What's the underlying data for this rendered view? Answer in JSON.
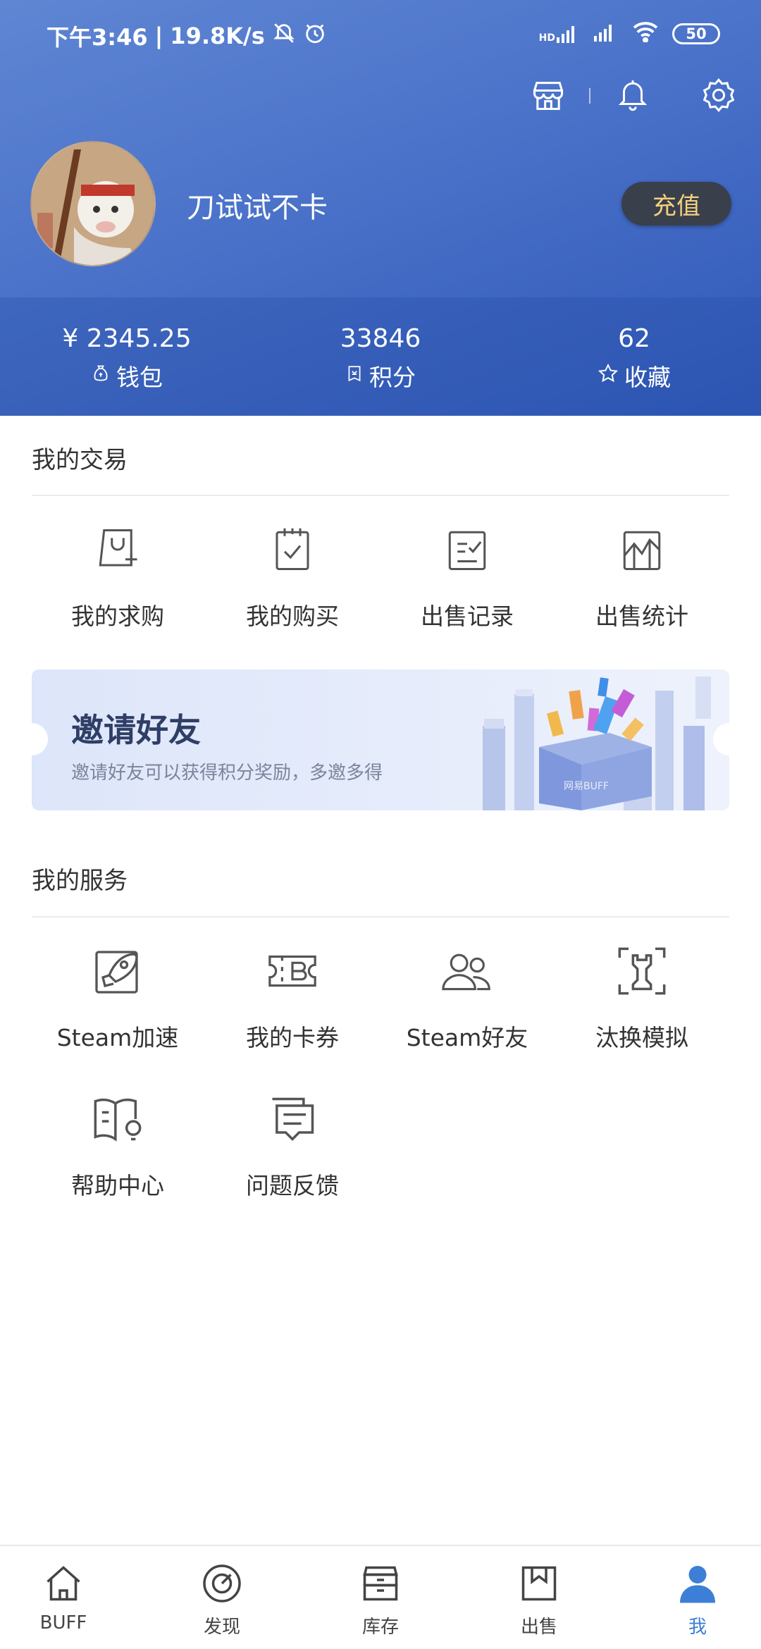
{
  "status_bar": {
    "time": "下午3:46",
    "speed": "19.8K/s",
    "network_label": "HD",
    "battery": "50"
  },
  "profile": {
    "username": "刀试试不卡",
    "recharge_label": "充值"
  },
  "stats": [
    {
      "value": "¥ 2345.25",
      "label": "钱包",
      "icon": "wallet-icon"
    },
    {
      "value": "33846",
      "label": "积分",
      "icon": "points-icon"
    },
    {
      "value": "62",
      "label": "收藏",
      "icon": "star-icon"
    }
  ],
  "trade": {
    "title": "我的交易",
    "items": [
      {
        "label": "我的求购",
        "icon": "bag-plus-icon"
      },
      {
        "label": "我的购买",
        "icon": "clipboard-check-icon"
      },
      {
        "label": "出售记录",
        "icon": "record-check-icon"
      },
      {
        "label": "出售统计",
        "icon": "chart-icon"
      }
    ]
  },
  "banner": {
    "title": "邀请好友",
    "subtitle": "邀请好友可以获得积分奖励，多邀多得",
    "box_text": "网易BUFF"
  },
  "services": {
    "title": "我的服务",
    "items": [
      {
        "label": "Steam加速",
        "icon": "rocket-icon"
      },
      {
        "label": "我的卡券",
        "icon": "ticket-icon"
      },
      {
        "label": "Steam好友",
        "icon": "friends-icon"
      },
      {
        "label": "汰换模拟",
        "icon": "tradeup-icon"
      },
      {
        "label": "帮助中心",
        "icon": "help-book-icon"
      },
      {
        "label": "问题反馈",
        "icon": "feedback-icon"
      }
    ]
  },
  "bottom_nav": [
    {
      "label": "BUFF",
      "icon": "home-icon"
    },
    {
      "label": "发现",
      "icon": "discover-icon"
    },
    {
      "label": "库存",
      "icon": "inventory-icon"
    },
    {
      "label": "出售",
      "icon": "sell-icon"
    },
    {
      "label": "我",
      "icon": "user-icon",
      "active": true
    }
  ],
  "colors": {
    "header_blue": "#4a72c9",
    "recharge_bg": "#3a3f4c",
    "recharge_text": "#f3d27d",
    "active_nav": "#3d7fd6"
  }
}
